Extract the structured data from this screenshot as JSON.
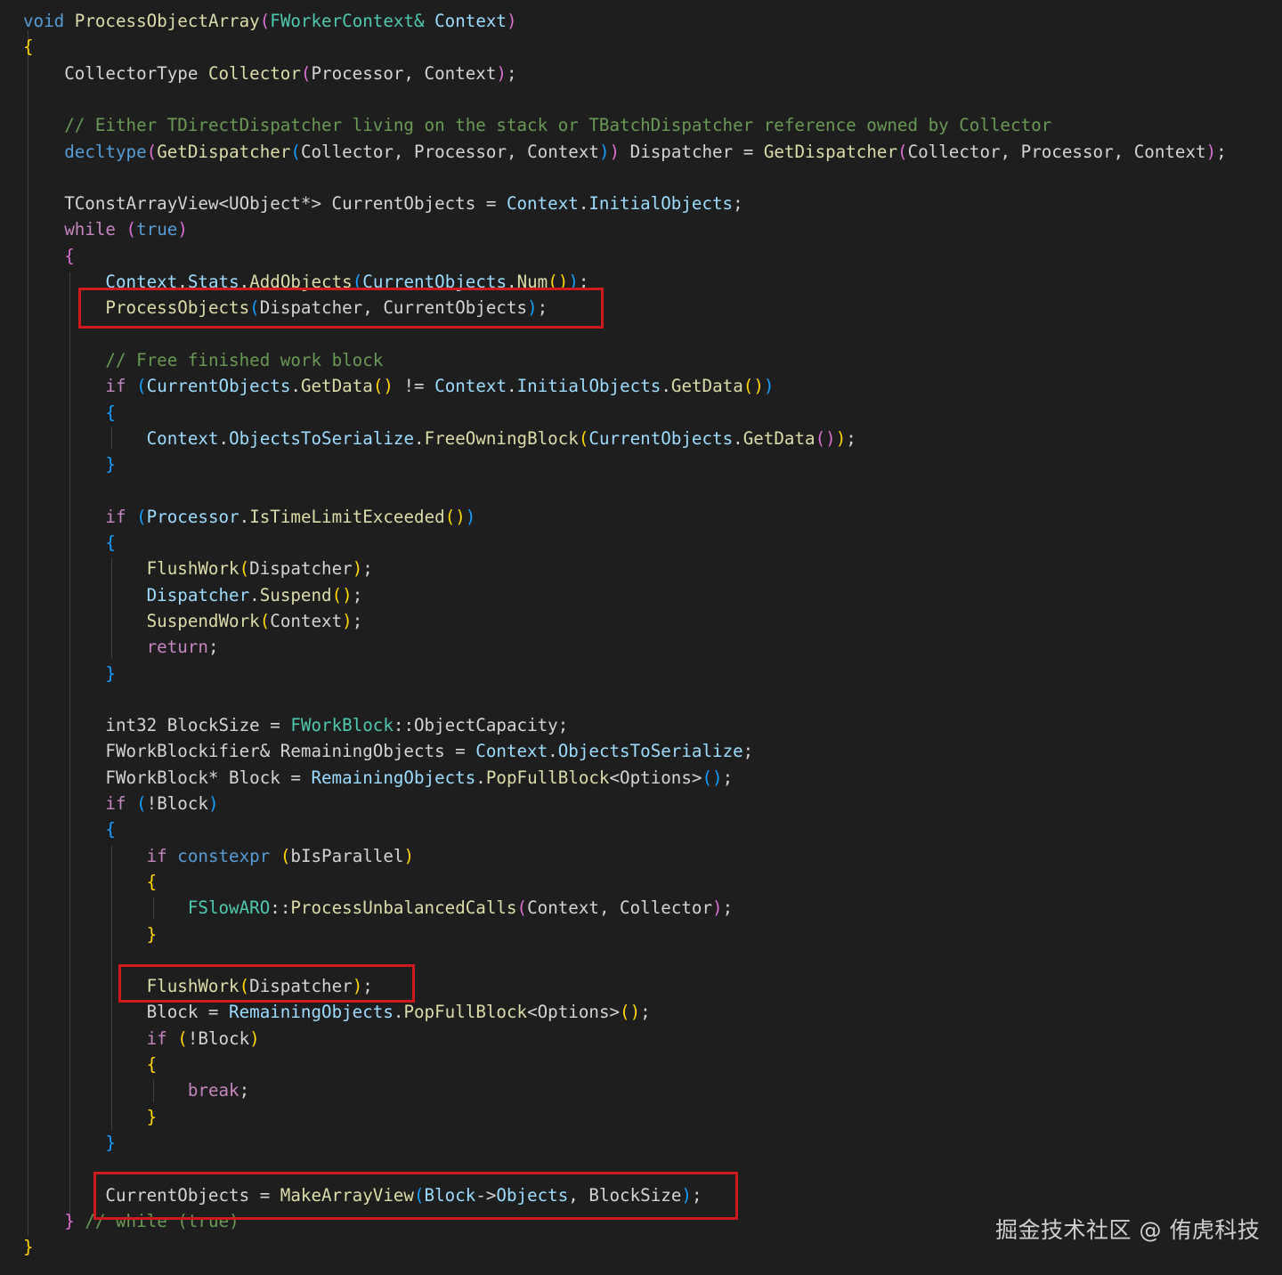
{
  "colors": {
    "background": "#1e1e1e",
    "keyword": "#569cd6",
    "control": "#c586c0",
    "function": "#dcdcaa",
    "variable": "#9cdcfe",
    "type": "#4ec9b0",
    "comment": "#6a9955",
    "plain": "#d4d4d4",
    "bracket1": "#ffd700",
    "bracket2": "#da70d6",
    "bracket3": "#179fff",
    "highlight_box": "#d0191d"
  },
  "code": {
    "lines": [
      [
        [
          "void",
          "kw"
        ],
        [
          " "
        ],
        [
          "ProcessObjectArray",
          "fn"
        ],
        [
          "(",
          "b2"
        ],
        [
          "FWorkerContext&",
          "ty"
        ],
        [
          " "
        ],
        [
          "Context",
          "var"
        ],
        [
          ")",
          "b2"
        ]
      ],
      [
        [
          "{",
          "b1"
        ]
      ],
      [
        [
          "    CollectorType "
        ],
        [
          "Collector",
          "fn"
        ],
        [
          "(",
          "b2"
        ],
        [
          "Processor, Context"
        ],
        [
          ")",
          "b2"
        ],
        [
          ";"
        ]
      ],
      [],
      [
        [
          "    "
        ],
        [
          "// Either TDirectDispatcher living on the stack or TBatchDispatcher reference owned by Collector",
          "cm"
        ]
      ],
      [
        [
          "    "
        ],
        [
          "decltype",
          "kw"
        ],
        [
          "(",
          "b2"
        ],
        [
          "GetDispatcher",
          "fn"
        ],
        [
          "(",
          "b3"
        ],
        [
          "Collector, Processor, Context"
        ],
        [
          ")",
          "b3"
        ],
        [
          ")",
          "b2"
        ],
        [
          " Dispatcher = "
        ],
        [
          "GetDispatcher",
          "fn"
        ],
        [
          "(",
          "b2"
        ],
        [
          "Collector, Processor, Context"
        ],
        [
          ")",
          "b2"
        ],
        [
          ";"
        ]
      ],
      [],
      [
        [
          "    TConstArrayView<UObject*> CurrentObjects = "
        ],
        [
          "Context",
          "var"
        ],
        [
          "."
        ],
        [
          "InitialObjects",
          "var"
        ],
        [
          ";"
        ]
      ],
      [
        [
          "    "
        ],
        [
          "while",
          "ctl"
        ],
        [
          " "
        ],
        [
          "(",
          "b2"
        ],
        [
          "true",
          "kw"
        ],
        [
          ")",
          "b2"
        ]
      ],
      [
        [
          "    "
        ],
        [
          "{",
          "b2"
        ]
      ],
      [
        [
          "        "
        ],
        [
          "Context",
          "var"
        ],
        [
          "."
        ],
        [
          "Stats",
          "var"
        ],
        [
          "."
        ],
        [
          "AddObjects",
          "fn"
        ],
        [
          "(",
          "b3"
        ],
        [
          "CurrentObjects",
          "var"
        ],
        [
          "."
        ],
        [
          "Num",
          "fn"
        ],
        [
          "()",
          "b1"
        ],
        [
          ")",
          "b3"
        ],
        [
          ";"
        ]
      ],
      [
        [
          "        "
        ],
        [
          "ProcessObjects",
          "fn"
        ],
        [
          "(",
          "b3"
        ],
        [
          "Dispatcher, CurrentObjects"
        ],
        [
          ")",
          "b3"
        ],
        [
          ";"
        ]
      ],
      [],
      [
        [
          "        "
        ],
        [
          "// Free finished work block",
          "cm"
        ]
      ],
      [
        [
          "        "
        ],
        [
          "if",
          "ctl"
        ],
        [
          " "
        ],
        [
          "(",
          "b3"
        ],
        [
          "CurrentObjects",
          "var"
        ],
        [
          "."
        ],
        [
          "GetData",
          "fn"
        ],
        [
          "()",
          "b1"
        ],
        [
          " != "
        ],
        [
          "Context",
          "var"
        ],
        [
          "."
        ],
        [
          "InitialObjects",
          "var"
        ],
        [
          "."
        ],
        [
          "GetData",
          "fn"
        ],
        [
          "()",
          "b1"
        ],
        [
          ")",
          "b3"
        ]
      ],
      [
        [
          "        "
        ],
        [
          "{",
          "b3"
        ]
      ],
      [
        [
          "            "
        ],
        [
          "Context",
          "var"
        ],
        [
          "."
        ],
        [
          "ObjectsToSerialize",
          "var"
        ],
        [
          "."
        ],
        [
          "FreeOwningBlock",
          "fn"
        ],
        [
          "(",
          "b1"
        ],
        [
          "CurrentObjects",
          "var"
        ],
        [
          "."
        ],
        [
          "GetData",
          "fn"
        ],
        [
          "()",
          "b2"
        ],
        [
          ")",
          "b1"
        ],
        [
          ";"
        ]
      ],
      [
        [
          "        "
        ],
        [
          "}",
          "b3"
        ]
      ],
      [],
      [
        [
          "        "
        ],
        [
          "if",
          "ctl"
        ],
        [
          " "
        ],
        [
          "(",
          "b3"
        ],
        [
          "Processor",
          "var"
        ],
        [
          "."
        ],
        [
          "IsTimeLimitExceeded",
          "fn"
        ],
        [
          "()",
          "b1"
        ],
        [
          ")",
          "b3"
        ]
      ],
      [
        [
          "        "
        ],
        [
          "{",
          "b3"
        ]
      ],
      [
        [
          "            "
        ],
        [
          "FlushWork",
          "fn"
        ],
        [
          "(",
          "b1"
        ],
        [
          "Dispatcher"
        ],
        [
          ")",
          "b1"
        ],
        [
          ";"
        ]
      ],
      [
        [
          "            "
        ],
        [
          "Dispatcher",
          "var"
        ],
        [
          "."
        ],
        [
          "Suspend",
          "fn"
        ],
        [
          "()",
          "b1"
        ],
        [
          ";"
        ]
      ],
      [
        [
          "            "
        ],
        [
          "SuspendWork",
          "fn"
        ],
        [
          "(",
          "b1"
        ],
        [
          "Context"
        ],
        [
          ")",
          "b1"
        ],
        [
          ";"
        ]
      ],
      [
        [
          "            "
        ],
        [
          "return",
          "ctl"
        ],
        [
          ";"
        ]
      ],
      [
        [
          "        "
        ],
        [
          "}",
          "b3"
        ]
      ],
      [],
      [
        [
          "        int32 BlockSize = "
        ],
        [
          "FWorkBlock",
          "ty"
        ],
        [
          "::ObjectCapacity;"
        ]
      ],
      [
        [
          "        FWorkBlockifier& RemainingObjects = "
        ],
        [
          "Context",
          "var"
        ],
        [
          "."
        ],
        [
          "ObjectsToSerialize",
          "var"
        ],
        [
          ";"
        ]
      ],
      [
        [
          "        FWorkBlock* Block = "
        ],
        [
          "RemainingObjects",
          "var"
        ],
        [
          "."
        ],
        [
          "PopFullBlock",
          "fn"
        ],
        [
          "<Options>"
        ],
        [
          "()",
          "b3"
        ],
        [
          ";"
        ]
      ],
      [
        [
          "        "
        ],
        [
          "if",
          "ctl"
        ],
        [
          " "
        ],
        [
          "(",
          "b3"
        ],
        [
          "!Block"
        ],
        [
          ")",
          "b3"
        ]
      ],
      [
        [
          "        "
        ],
        [
          "{",
          "b3"
        ]
      ],
      [
        [
          "            "
        ],
        [
          "if",
          "ctl"
        ],
        [
          " "
        ],
        [
          "constexpr",
          "kw"
        ],
        [
          " "
        ],
        [
          "(",
          "b1"
        ],
        [
          "bIsParallel"
        ],
        [
          ")",
          "b1"
        ]
      ],
      [
        [
          "            "
        ],
        [
          "{",
          "b1"
        ]
      ],
      [
        [
          "                "
        ],
        [
          "FSlowARO",
          "ty"
        ],
        [
          "::"
        ],
        [
          "ProcessUnbalancedCalls",
          "fn"
        ],
        [
          "(",
          "b2"
        ],
        [
          "Context, Collector"
        ],
        [
          ")",
          "b2"
        ],
        [
          ";"
        ]
      ],
      [
        [
          "            "
        ],
        [
          "}",
          "b1"
        ]
      ],
      [],
      [
        [
          "            "
        ],
        [
          "FlushWork",
          "fn"
        ],
        [
          "(",
          "b1"
        ],
        [
          "Dispatcher"
        ],
        [
          ")",
          "b1"
        ],
        [
          ";"
        ]
      ],
      [
        [
          "            Block = "
        ],
        [
          "RemainingObjects",
          "var"
        ],
        [
          "."
        ],
        [
          "PopFullBlock",
          "fn"
        ],
        [
          "<Options>"
        ],
        [
          "()",
          "b1"
        ],
        [
          ";"
        ]
      ],
      [
        [
          "            "
        ],
        [
          "if",
          "ctl"
        ],
        [
          " "
        ],
        [
          "(",
          "b1"
        ],
        [
          "!Block"
        ],
        [
          ")",
          "b1"
        ]
      ],
      [
        [
          "            "
        ],
        [
          "{",
          "b1"
        ]
      ],
      [
        [
          "                "
        ],
        [
          "break",
          "ctl"
        ],
        [
          ";"
        ]
      ],
      [
        [
          "            "
        ],
        [
          "}",
          "b1"
        ]
      ],
      [
        [
          "        "
        ],
        [
          "}",
          "b3"
        ]
      ],
      [],
      [
        [
          "        CurrentObjects = "
        ],
        [
          "MakeArrayView",
          "fn"
        ],
        [
          "(",
          "b3"
        ],
        [
          "Block",
          "var"
        ],
        [
          "->"
        ],
        [
          "Objects",
          "var"
        ],
        [
          ", BlockSize"
        ],
        [
          ")",
          "b3"
        ],
        [
          ";"
        ]
      ],
      [
        [
          "    "
        ],
        [
          "}",
          "b2"
        ],
        [
          " "
        ],
        [
          "// while (true)",
          "cm"
        ]
      ],
      [
        [
          "}",
          "b1"
        ]
      ]
    ]
  },
  "watermark": "掘金技术社区 @ 侑虎科技"
}
